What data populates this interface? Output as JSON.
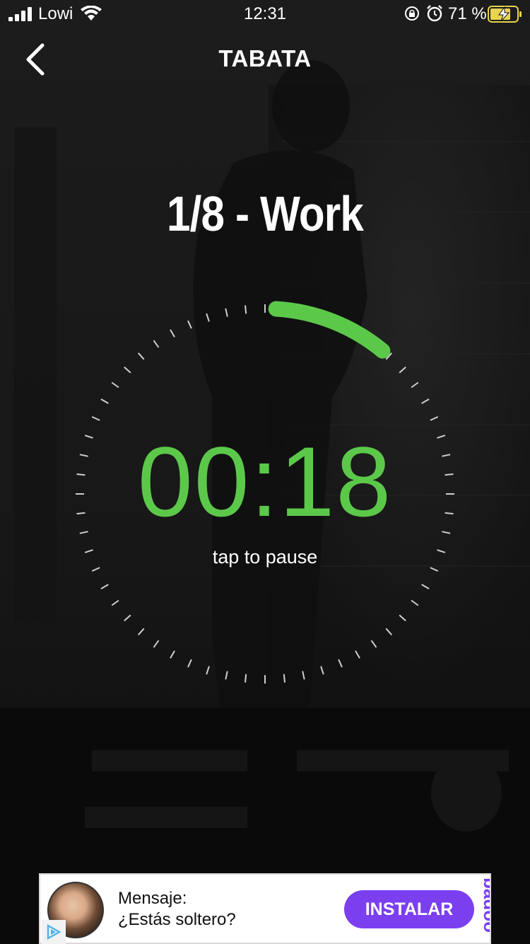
{
  "status_bar": {
    "carrier": "Lowi",
    "time": "12:31",
    "battery_percent": "71 %",
    "icons": [
      "signal-icon",
      "wifi-icon",
      "orientation-lock-icon",
      "alarm-icon",
      "battery-charging-icon"
    ]
  },
  "nav": {
    "back_icon": "chevron-left-icon",
    "title": "TABATA"
  },
  "workout": {
    "round_label": "1/8 - Work",
    "time_remaining": "00:18",
    "hint": "tap to pause",
    "progress_fraction": 0.1,
    "tick_count": 60,
    "progress_color": "#5cc84a"
  },
  "ad": {
    "line1": "Mensaje:",
    "line2": "¿Estás soltero?",
    "cta": "INSTALAR",
    "brand": "badoo",
    "cta_color": "#7b3ff0"
  }
}
